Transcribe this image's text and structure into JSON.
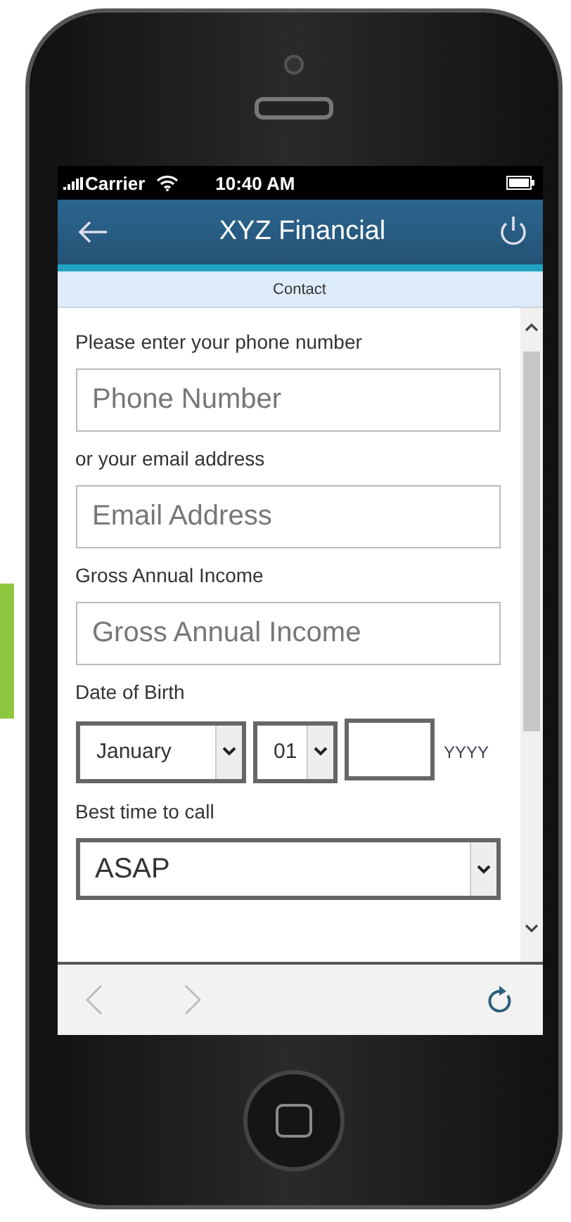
{
  "status_bar": {
    "carrier": "Carrier",
    "time": "10:40 AM"
  },
  "header": {
    "title": "XYZ Financial"
  },
  "section": {
    "title": "Contact"
  },
  "form": {
    "fields": [
      {
        "kind": "text",
        "label": "Please enter your phone number",
        "placeholder": "Phone Number"
      },
      {
        "kind": "text",
        "label": "or your email address",
        "placeholder": "Email Address"
      },
      {
        "kind": "text",
        "label": "Gross Annual Income",
        "placeholder": "Gross Annual Income"
      },
      {
        "kind": "date",
        "label": "Date of Birth",
        "month": "January",
        "day": "01",
        "year_hint": "YYYY"
      },
      {
        "kind": "select",
        "label": "Best time to call",
        "value": "ASAP"
      }
    ]
  }
}
